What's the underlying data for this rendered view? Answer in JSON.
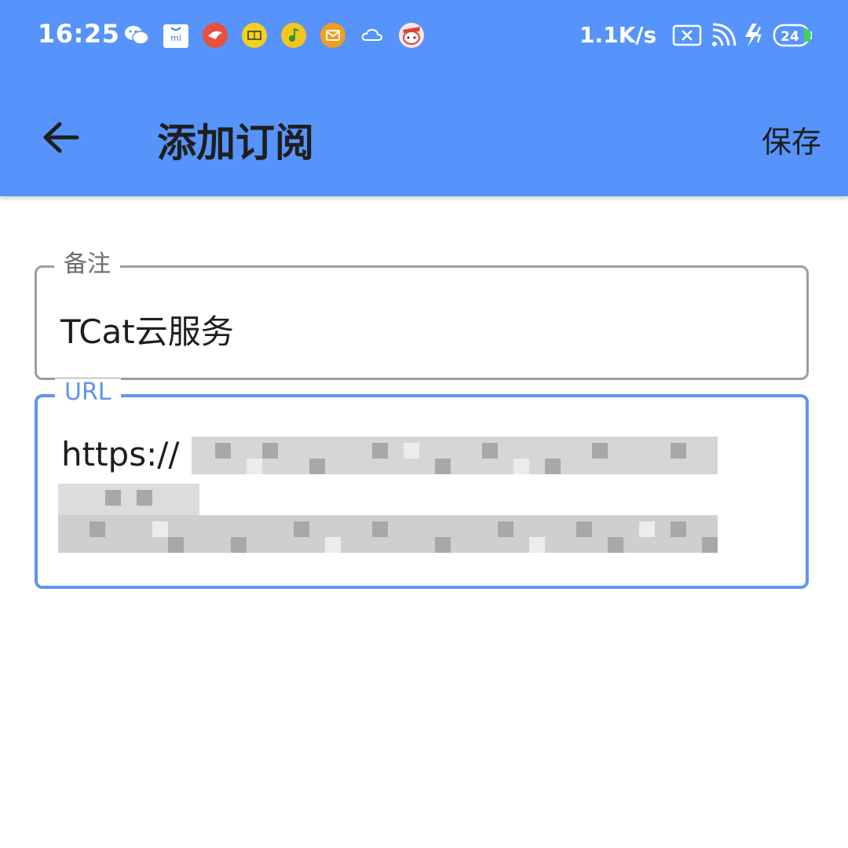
{
  "status_bar": {
    "time": "16:25",
    "net_speed": "1.1K/s",
    "battery": "24",
    "notification_icons": [
      "wechat-icon",
      "mi-store-icon",
      "red-bird-icon",
      "yellow-app-icon",
      "music-icon",
      "mail-icon",
      "cloud-icon",
      "game-icon"
    ],
    "system_icons": [
      "sim-off-icon",
      "wifi-icon",
      "charging-icon",
      "battery-icon"
    ]
  },
  "appbar": {
    "title": "添加订阅",
    "save_label": "保存",
    "back_icon": "arrow-left-icon"
  },
  "form": {
    "note": {
      "label": "备注",
      "value": "TCat云服务"
    },
    "url": {
      "label": "URL",
      "value": "https://"
    }
  },
  "colors": {
    "primary": "#5694fb",
    "focus": "#5f95ee",
    "outline": "#9e9e9e"
  }
}
